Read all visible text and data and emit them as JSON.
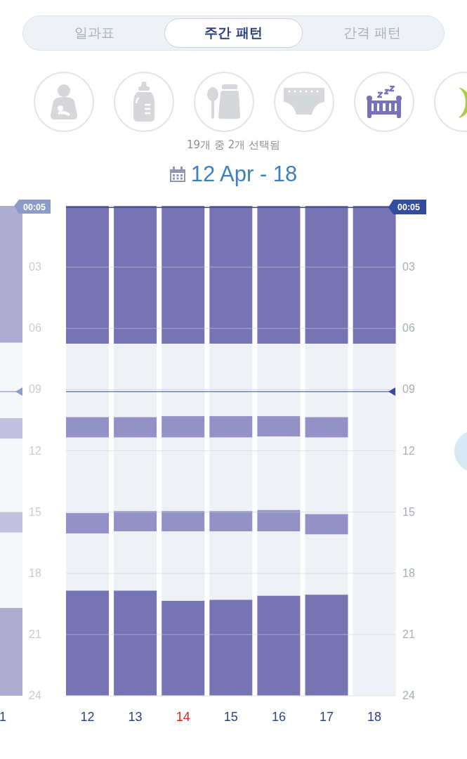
{
  "tabs": [
    {
      "label": "일과표",
      "selected": false
    },
    {
      "label": "주간 패턴",
      "selected": true
    },
    {
      "label": "간격 패턴",
      "selected": false
    }
  ],
  "categories": [
    {
      "selected": false
    },
    {
      "selected": false
    },
    {
      "selected": false
    },
    {
      "selected": false
    },
    {
      "selected": true
    },
    {
      "selected": true
    }
  ],
  "selection_caption": "19개 중 2개 선택됨",
  "date_range": "12 Apr - 18",
  "previous_week": {
    "time_badge": "00:05",
    "axis_labels": [
      "03",
      "06",
      "09",
      "12",
      "15",
      "18",
      "21",
      "24"
    ],
    "day_label": "1"
  },
  "day_labels": [
    {
      "color": "#2f4585"
    },
    {
      "color": "#2f4585"
    },
    {
      "color": "#e5231e"
    },
    {
      "color": "#2f4585"
    },
    {
      "color": "#2f4585"
    },
    {
      "color": "#2f4585"
    },
    {
      "color": "#2f4585"
    }
  ],
  "chart_data": {
    "type": "bar",
    "stacked": true,
    "orientation": "vertical",
    "categories": [
      "12",
      "13",
      "14",
      "15",
      "16",
      "17",
      "18"
    ],
    "series": [
      {
        "color": "#7674b2",
        "values": [
          6.75,
          6.75,
          6.75,
          6.75,
          6.75,
          6.75,
          6.75
        ]
      },
      {
        "color": "#eef1f5",
        "values": [
          3.6,
          3.6,
          3.55,
          3.55,
          3.55,
          3.6,
          null
        ]
      },
      {
        "color": "#9391c6",
        "values": [
          1.0,
          1.0,
          1.05,
          1.05,
          1.0,
          1.0,
          null
        ]
      },
      {
        "color": "#eef1f5",
        "values": [
          3.7,
          3.6,
          3.6,
          3.6,
          3.6,
          3.75,
          null
        ]
      },
      {
        "color": "#9391c6",
        "values": [
          1.0,
          1.0,
          1.0,
          1.0,
          1.05,
          1.0,
          null
        ]
      },
      {
        "color": "#eef1f5",
        "values": [
          2.8,
          2.9,
          3.4,
          3.35,
          3.15,
          2.95,
          null
        ]
      },
      {
        "color": "#7674b2",
        "values": [
          5.15,
          5.15,
          4.65,
          4.7,
          4.9,
          4.95,
          null
        ]
      }
    ],
    "ylim": [
      24,
      0
    ],
    "yticks": [
      {
        "value": 3,
        "label": "03"
      },
      {
        "value": 6,
        "label": "06"
      },
      {
        "value": 9,
        "label": "09"
      },
      {
        "value": 12,
        "label": "12"
      },
      {
        "value": 15,
        "label": "15"
      },
      {
        "value": 18,
        "label": "18"
      },
      {
        "value": 21,
        "label": "21"
      },
      {
        "value": 24,
        "label": "24"
      }
    ],
    "grid": true,
    "ref_lines": [
      {
        "axis": "y",
        "value": 0.08,
        "label": "00:05"
      },
      {
        "axis": "y",
        "value": 9.1
      }
    ]
  }
}
